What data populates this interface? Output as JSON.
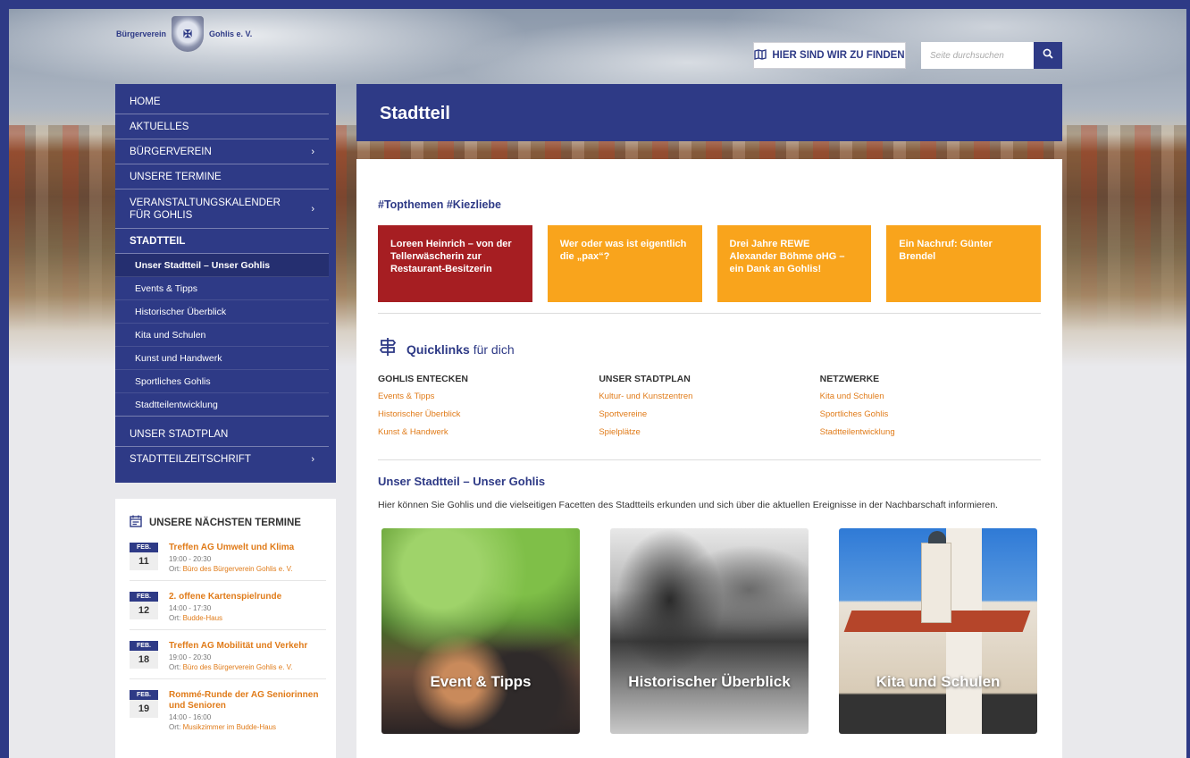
{
  "brand": {
    "left": "Bürgerverein",
    "right": "Gohlis e. V."
  },
  "header_actions": {
    "find_us": "HIER SIND WIR ZU FINDEN",
    "search_placeholder": "Seite durchsuchen"
  },
  "nav": {
    "items": [
      {
        "label": "HOME"
      },
      {
        "label": "AKTUELLES"
      },
      {
        "label": "BÜRGERVEREIN",
        "has_submenu": true
      },
      {
        "label": "UNSERE TERMINE"
      },
      {
        "label": "VERANSTALTUNGSKALENDER FÜR GOHLIS",
        "has_submenu": true
      },
      {
        "label": "STADTTEIL",
        "active": true
      },
      {
        "label": "UNSER STADTPLAN"
      },
      {
        "label": "STADTTEILZEITSCHRIFT",
        "has_submenu": true
      }
    ],
    "subitems": [
      {
        "label": "Unser Stadtteil – Unser Gohlis",
        "active": true
      },
      {
        "label": "Events & Tipps"
      },
      {
        "label": "Historischer Überblick"
      },
      {
        "label": "Kita und Schulen"
      },
      {
        "label": "Kunst und Handwerk"
      },
      {
        "label": "Sportliches Gohlis"
      },
      {
        "label": "Stadtteilentwicklung"
      }
    ]
  },
  "events": {
    "title": "UNSERE NÄCHSTEN TERMINE",
    "items": [
      {
        "month": "FEB.",
        "day": "11",
        "title": "Treffen AG Umwelt und Klima",
        "time": "19:00 - 20:30",
        "loc_prefix": "Ort:",
        "loc": "Büro des Bürgerverein Gohlis e. V."
      },
      {
        "month": "FEB.",
        "day": "12",
        "title": "2. offene Kartenspielrunde",
        "time": "14:00 - 17:30",
        "loc_prefix": "Ort:",
        "loc": "Budde-Haus"
      },
      {
        "month": "FEB.",
        "day": "18",
        "title": "Treffen AG Mobilität und Verkehr",
        "time": "19:00 - 20:30",
        "loc_prefix": "Ort:",
        "loc": "Büro des Bürgerverein Gohlis e. V."
      },
      {
        "month": "FEB.",
        "day": "19",
        "title": "Rommé-Runde der AG Seniorinnen und Senioren",
        "time": "14:00 - 16:00",
        "loc_prefix": "Ort:",
        "loc": "Musikzimmer im Budde-Haus"
      }
    ]
  },
  "page": {
    "title": "Stadtteil",
    "topthemen": "#Topthemen #Kiezliebe",
    "tiles": [
      {
        "text": "Loreen Heinrich – von der Tellerwäscherin zur Restaurant-Besitzerin",
        "color": "#a61e22"
      },
      {
        "text": "Wer oder was ist eigentlich die „pax“?",
        "color": "#f9a41c"
      },
      {
        "text": "Drei Jahre REWE Alexander Böhme oHG – ein Dank an Gohlis!",
        "color": "#f9a41c"
      },
      {
        "text": "Ein Nachruf: Günter Brendel",
        "color": "#f9a41c"
      }
    ],
    "quicklinks": {
      "bold": "Quicklinks",
      "rest": "für dich",
      "columns": [
        {
          "title": "GOHLIS ENTECKEN",
          "links": [
            "Events & Tipps",
            "Historischer Überblick",
            "Kunst & Handwerk"
          ]
        },
        {
          "title": "UNSER STADTPLAN",
          "links": [
            "Kultur- und Kunstzentren",
            "Sportvereine",
            "Spielplätze"
          ]
        },
        {
          "title": "NETZWERKE",
          "links": [
            "Kita und Schulen",
            "Sportliches Gohlis",
            "Stadtteilentwicklung"
          ]
        }
      ]
    },
    "section_title": "Unser Stadtteil – Unser Gohlis",
    "intro": "Hier können Sie Gohlis und die vielseitigen Facetten des Stadtteils erkunden und sich über die aktuellen Ereignisse in der Nachbarschaft informieren.",
    "cards": [
      {
        "label": "Event & Tipps"
      },
      {
        "label": "Historischer Überblick"
      },
      {
        "label": "Kita und Schulen"
      }
    ]
  },
  "colors": {
    "brand_blue": "#2e3a86",
    "accent_orange": "#f9a41c",
    "accent_red": "#a61e22",
    "link_orange": "#e07b19"
  }
}
